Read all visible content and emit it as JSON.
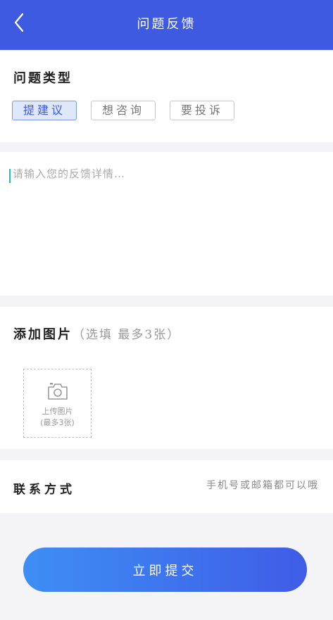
{
  "header": {
    "title": "问题反馈"
  },
  "problem_type": {
    "label": "问题类型",
    "options": [
      {
        "label": "提建议",
        "selected": true
      },
      {
        "label": "想咨询",
        "selected": false
      },
      {
        "label": "要投诉",
        "selected": false
      }
    ]
  },
  "feedback": {
    "value": "",
    "placeholder": "请输入您的反馈详情…"
  },
  "images": {
    "title": "添加图片",
    "hint": "（选填 最多3张）",
    "upload_label": "上传图片",
    "upload_sub": "(最多3张)"
  },
  "contact": {
    "label": "联系方式",
    "value": "",
    "placeholder": "手机号或邮箱都可以哦"
  },
  "submit": {
    "label": "立即提交"
  },
  "colors": {
    "header_bg": "#3d5ae0",
    "selected_chip_bg": "#dfe7fb",
    "button_start": "#3e8ef5",
    "button_end": "#3f5ce6"
  },
  "icons": {
    "back": "chevron-left-icon",
    "camera": "camera-icon"
  }
}
